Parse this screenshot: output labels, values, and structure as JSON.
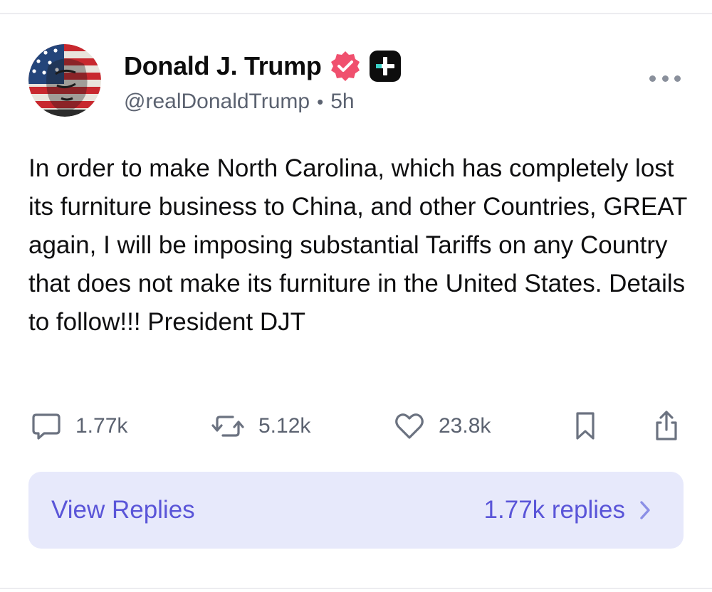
{
  "post": {
    "display_name": "Donald J. Trump",
    "handle": "@realDonaldTrump",
    "separator": "•",
    "time_ago": "5h",
    "body": "In order to make North Carolina, which has completely lost its furniture business to China, and other Countries, GREAT again, I will be imposing substantial Tariffs on any Country that does not make its furniture in the United States. Details to follow!!! President DJT"
  },
  "icons": {
    "avatar": "flag-portrait-avatar",
    "verified": "verified-badge-icon",
    "plus": "plus-badge-icon",
    "more": "more-options-icon",
    "comment": "comment-icon",
    "repost": "repost-icon",
    "like": "heart-icon",
    "bookmark": "bookmark-icon",
    "share": "share-icon",
    "chevron": "chevron-right-icon"
  },
  "actions": {
    "comments": "1.77k",
    "reposts": "5.12k",
    "likes": "23.8k"
  },
  "replies": {
    "label": "View Replies",
    "count_label": "1.77k replies"
  },
  "colors": {
    "verified": "#f0506e",
    "accent": "#5a55d8",
    "replies_bg": "#e7e9fb",
    "muted": "#5b6270"
  }
}
